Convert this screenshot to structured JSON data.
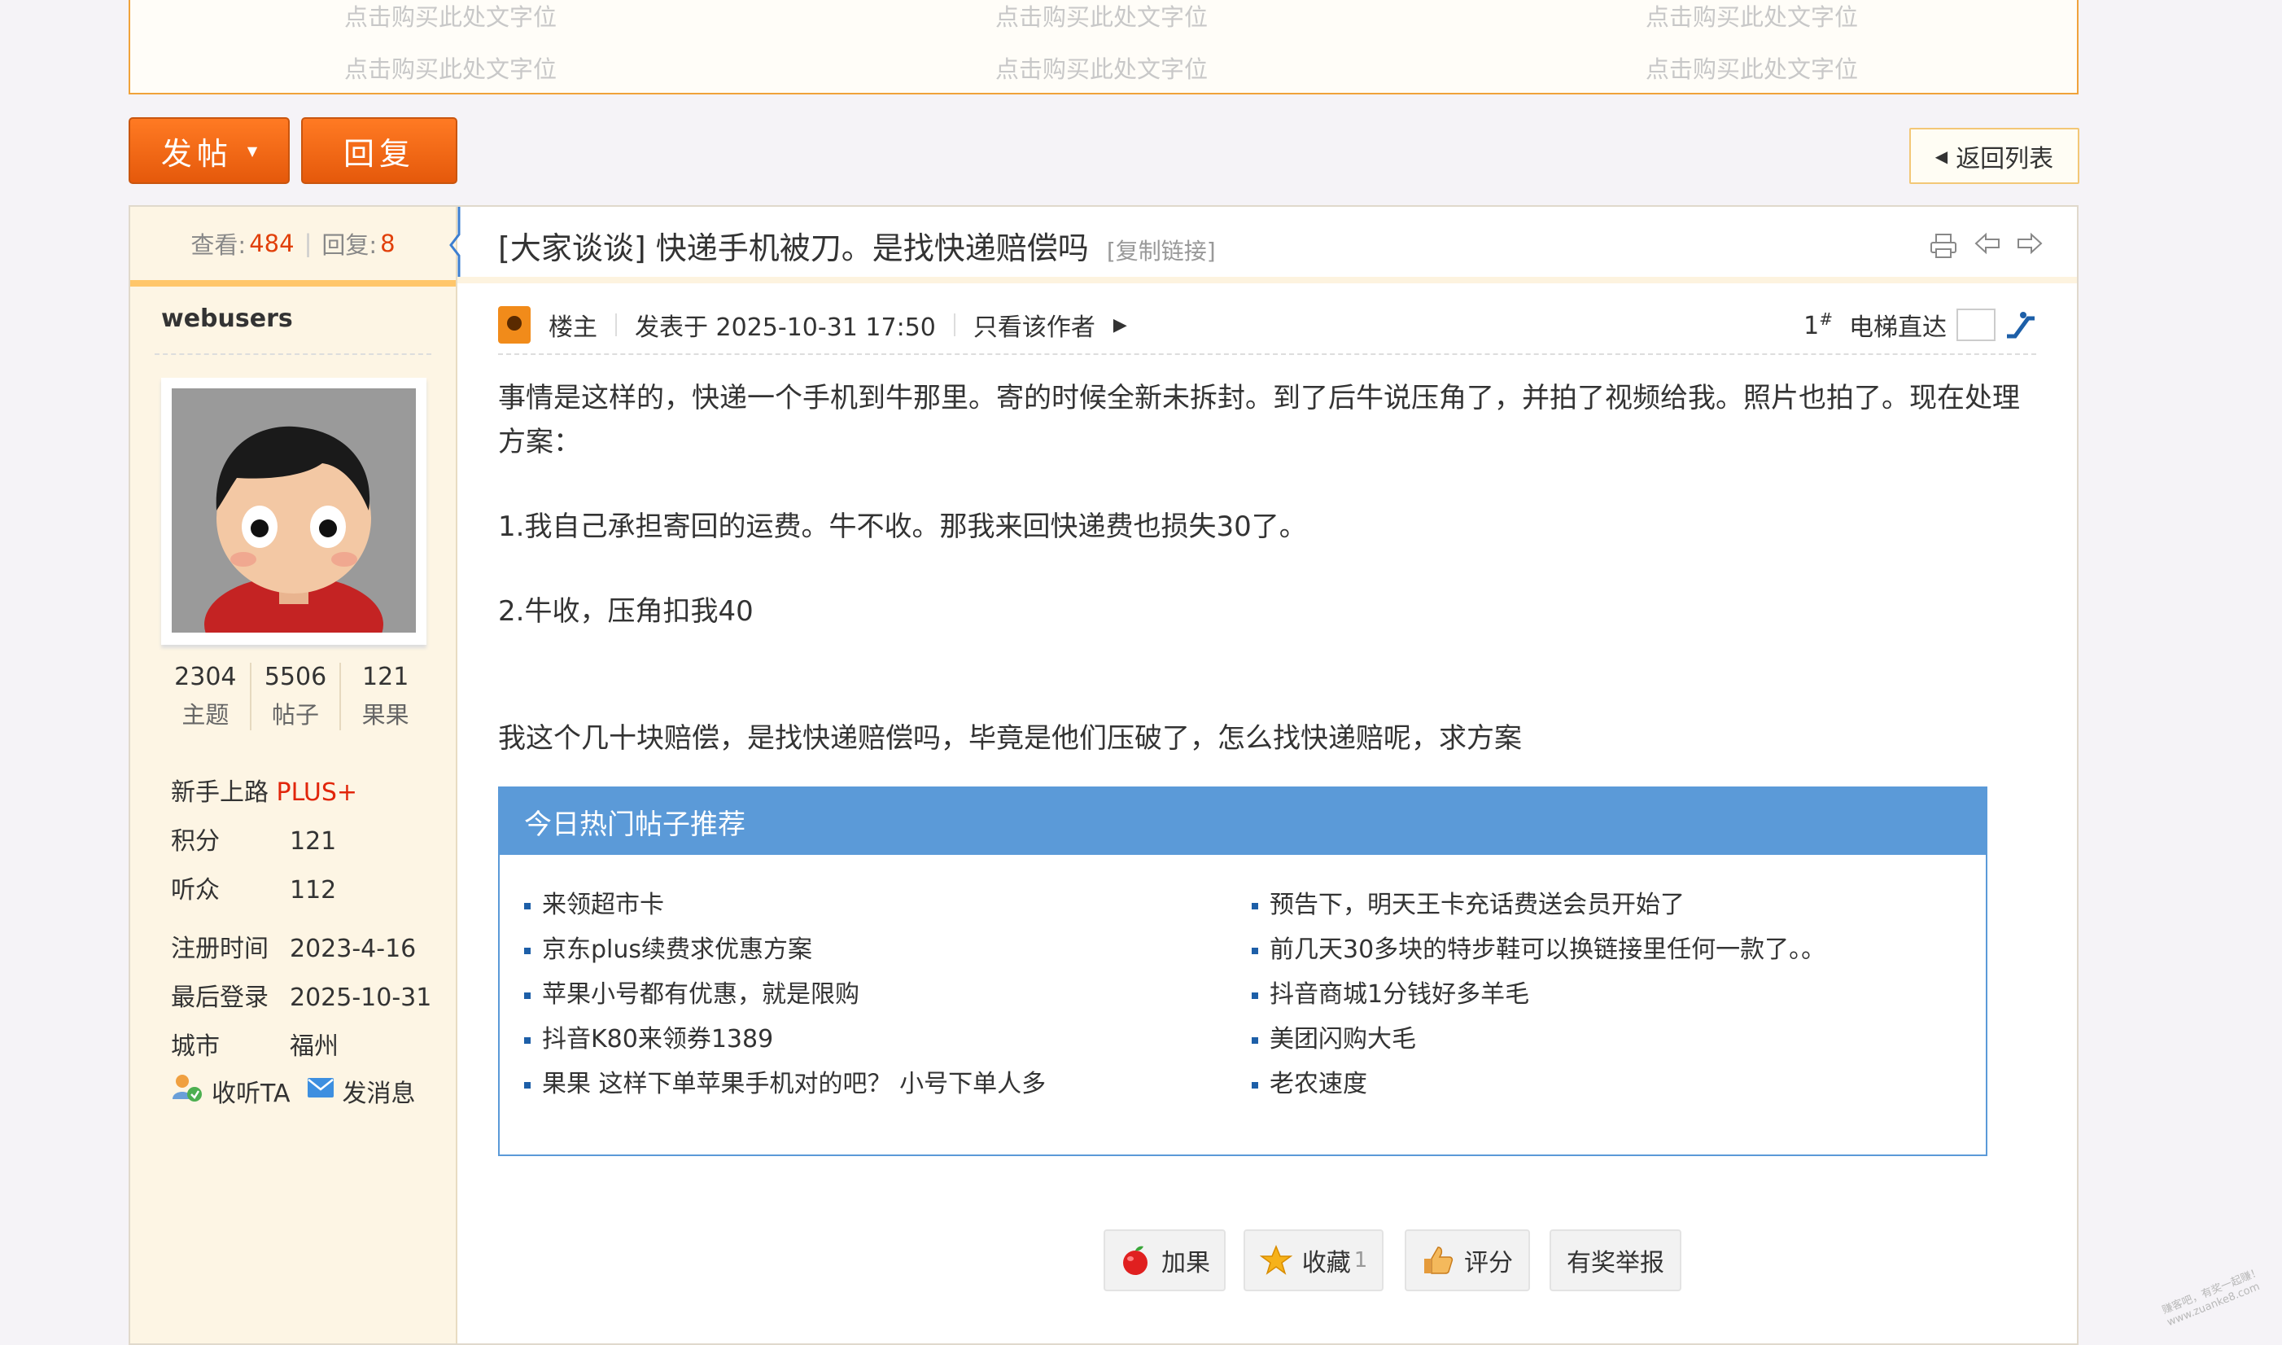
{
  "ad": {
    "cells": [
      "点击购买此处文字位",
      "点击购买此处文字位",
      "点击购买此处文字位",
      "点击购买此处文字位",
      "点击购买此处文字位",
      "点击购买此处文字位"
    ]
  },
  "toolbar": {
    "post_label": "发帖",
    "reply_label": "回复",
    "back_label": "返回列表"
  },
  "sidebar": {
    "views_label": "查看:",
    "views": "484",
    "replies_label": "回复:",
    "replies": "8",
    "username": "webusers",
    "stats": [
      {
        "value": "2304",
        "label": "主题"
      },
      {
        "value": "5506",
        "label": "帖子"
      },
      {
        "value": "121",
        "label": "果果"
      }
    ],
    "rank_label": "新手上路",
    "rank_badge": "PLUS+",
    "info": [
      {
        "key": "积分",
        "value": "121"
      },
      {
        "key": "听众",
        "value": "112"
      },
      {
        "key": "注册时间",
        "value": "2023-4-16"
      },
      {
        "key": "最后登录",
        "value": "2025-10-31"
      },
      {
        "key": "城市",
        "value": "福州"
      }
    ],
    "follow_label": "收听TA",
    "message_label": "发消息"
  },
  "post": {
    "title": "[大家谈谈] 快递手机被刀。是找快递赔偿吗",
    "copy_link": "[复制链接]",
    "op_label": "楼主",
    "posted": "发表于 2025-10-31 17:50",
    "only_author": "只看该作者",
    "floor": "1",
    "floor_sup": "#",
    "elevator_label": "电梯直达",
    "paragraphs": [
      "事情是这样的，快递一个手机到牛那里。寄的时候全新未拆封。到了后牛说压角了，并拍了视频给我。照片也拍了。现在处理方案：",
      "1.我自己承担寄回的运费。牛不收。那我来回快递费也损失30了。",
      "2.牛收，压角扣我40",
      "我这个几十块赔偿，是找快递赔偿吗，毕竟是他们压破了，怎么找快递赔呢，求方案"
    ]
  },
  "hot": {
    "title": "今日热门帖子推荐",
    "left": [
      "来领超市卡",
      "京东plus续费求优惠方案",
      "苹果小号都有优惠，就是限购",
      "抖音K80来领券1389",
      "果果 这样下单苹果手机对的吧？ 小号下单人多"
    ],
    "right": [
      "预告下，明天王卡充话费送会员开始了",
      "前几天30多块的特步鞋可以换链接里任何一款了。。",
      "抖音商城1分钱好多羊毛",
      "美团闪购大毛",
      "老农速度"
    ]
  },
  "bottom": {
    "guo_label": "加果",
    "fav_label": "收藏",
    "fav_count": "1",
    "rate_label": "评分",
    "report_label": "有奖举报"
  },
  "colors": {
    "accent": "#f0671a",
    "link_blue": "#5b9ad8",
    "badge_red": "#e1260b"
  },
  "watermark": {
    "line1": "赚客吧，有奖一起赚！",
    "line2": "www.zuanke8.com"
  }
}
